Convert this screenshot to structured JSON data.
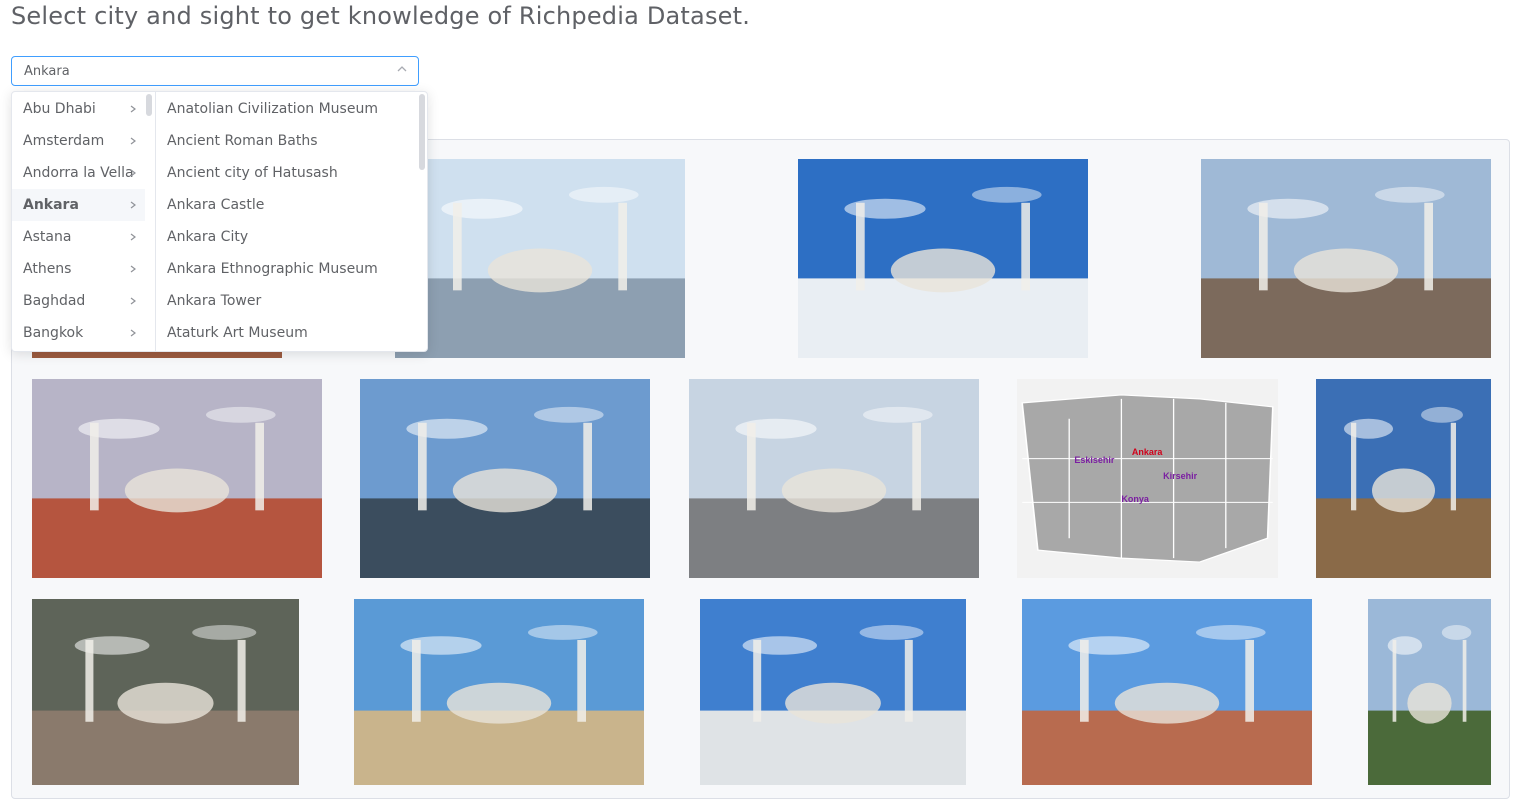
{
  "header": {
    "title": "Select city and sight to get knowledge of Richpedia Dataset."
  },
  "city_select": {
    "value": "Ankara"
  },
  "cascader": {
    "cities": [
      {
        "label": "Abu Dhabi",
        "active": false
      },
      {
        "label": "Amsterdam",
        "active": false
      },
      {
        "label": "Andorra la Vella",
        "active": false
      },
      {
        "label": "Ankara",
        "active": true
      },
      {
        "label": "Astana",
        "active": false
      },
      {
        "label": "Athens",
        "active": false
      },
      {
        "label": "Baghdad",
        "active": false
      },
      {
        "label": "Bangkok",
        "active": false
      }
    ],
    "sights": [
      {
        "label": "Anatolian Civilization Museum"
      },
      {
        "label": "Ancient Roman Baths"
      },
      {
        "label": "Ancient city of Hatusash"
      },
      {
        "label": "Ankara Castle"
      },
      {
        "label": "Ankara City"
      },
      {
        "label": "Ankara Ethnographic Museum"
      },
      {
        "label": "Ankara Tower"
      },
      {
        "label": "Ataturk Art Museum"
      }
    ]
  },
  "gallery": {
    "images": [
      {
        "name": "mosque-skyline-image",
        "sky": "#cfe0ef",
        "ground": "#8d9fb1"
      },
      {
        "name": "mosque-arcade-image",
        "sky": "#2d6fc4",
        "ground": "#e9eef3"
      },
      {
        "name": "hilltop-tourists-image",
        "sky": "#9fb9d6",
        "ground": "#7c6a5c"
      },
      {
        "name": "kocatepe-mosque-city-image",
        "sky": "#b7b4c7",
        "ground": "#b5553f"
      },
      {
        "name": "glass-building-image",
        "sky": "#6d9bcf",
        "ground": "#3b4d5e"
      },
      {
        "name": "city-square-image",
        "sky": "#c7d4e2",
        "ground": "#7d7f82"
      },
      {
        "name": "turkey-provinces-map-image",
        "sky": "#f2f2f2",
        "ground": "#a8a8a8"
      },
      {
        "name": "ancient-library-ruins-image",
        "sky": "#3b6fb5",
        "ground": "#8a6a48"
      },
      {
        "name": "smoke-over-city-image",
        "sky": "#5e6459",
        "ground": "#8a7a6c"
      },
      {
        "name": "mosque-domes-image",
        "sky": "#5a9ad6",
        "ground": "#c9b48c"
      },
      {
        "name": "white-mosque-image",
        "sky": "#3f7fcf",
        "ground": "#dfe3e6"
      },
      {
        "name": "old-town-hillside-image",
        "sky": "#5b9be0",
        "ground": "#b86b4f"
      },
      {
        "name": "ankara-collage-image",
        "sky": "#9bb8d8",
        "ground": "#4b6a3a"
      }
    ],
    "map_labels": [
      "Ankara",
      "Konya",
      "Eskisehir",
      "Kirsehir"
    ]
  }
}
